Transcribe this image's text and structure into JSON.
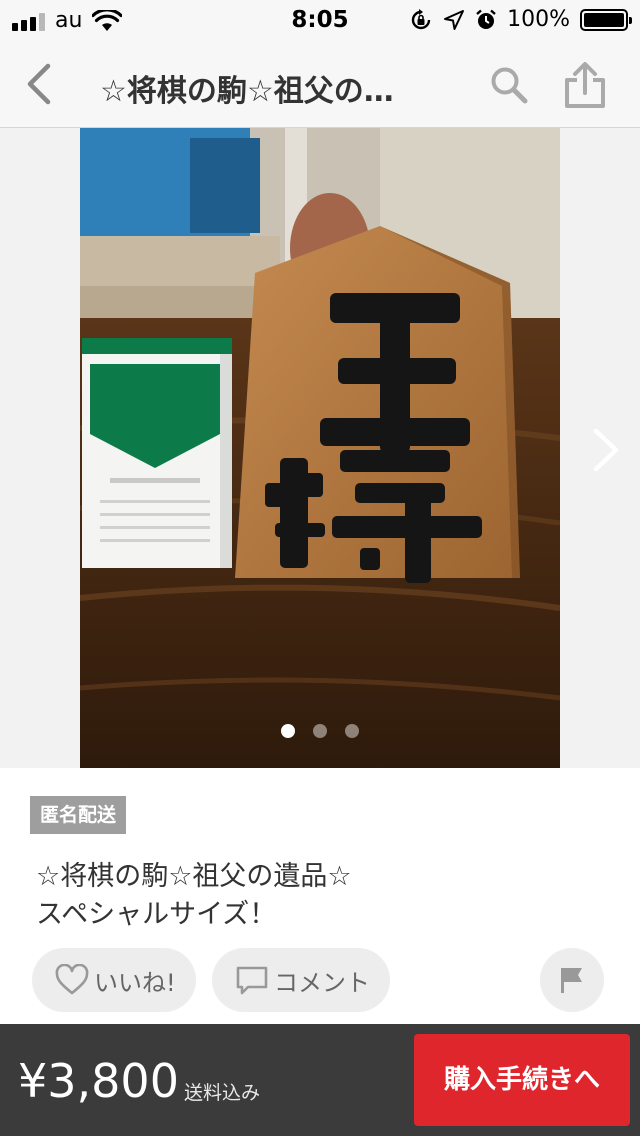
{
  "status_bar": {
    "carrier": "au",
    "time": "8:05",
    "battery_percent": "100%",
    "battery_level": 1.0
  },
  "nav": {
    "title": "☆将棋の駒☆祖父の…",
    "icons": [
      "back-chevron-icon",
      "search-icon",
      "share-icon"
    ]
  },
  "gallery": {
    "image_count": 3,
    "active_index": 0,
    "photo_alt": "将棋の駒 王将"
  },
  "item": {
    "badge": "匿名配送",
    "title_line1": "☆将棋の駒☆祖父の遺品☆",
    "title_line2": "スペシャルサイズ！",
    "like_label": "いいね!",
    "comment_label": "コメント"
  },
  "purchase": {
    "price": "¥3,800",
    "shipping_note": "送料込み",
    "buy_label": "購入手続きへ"
  },
  "colors": {
    "buy_button": "#e0262d",
    "bottom_bar": "#3b3b3b",
    "badge": "#9e9e9e",
    "pill_bg": "#ededed"
  }
}
